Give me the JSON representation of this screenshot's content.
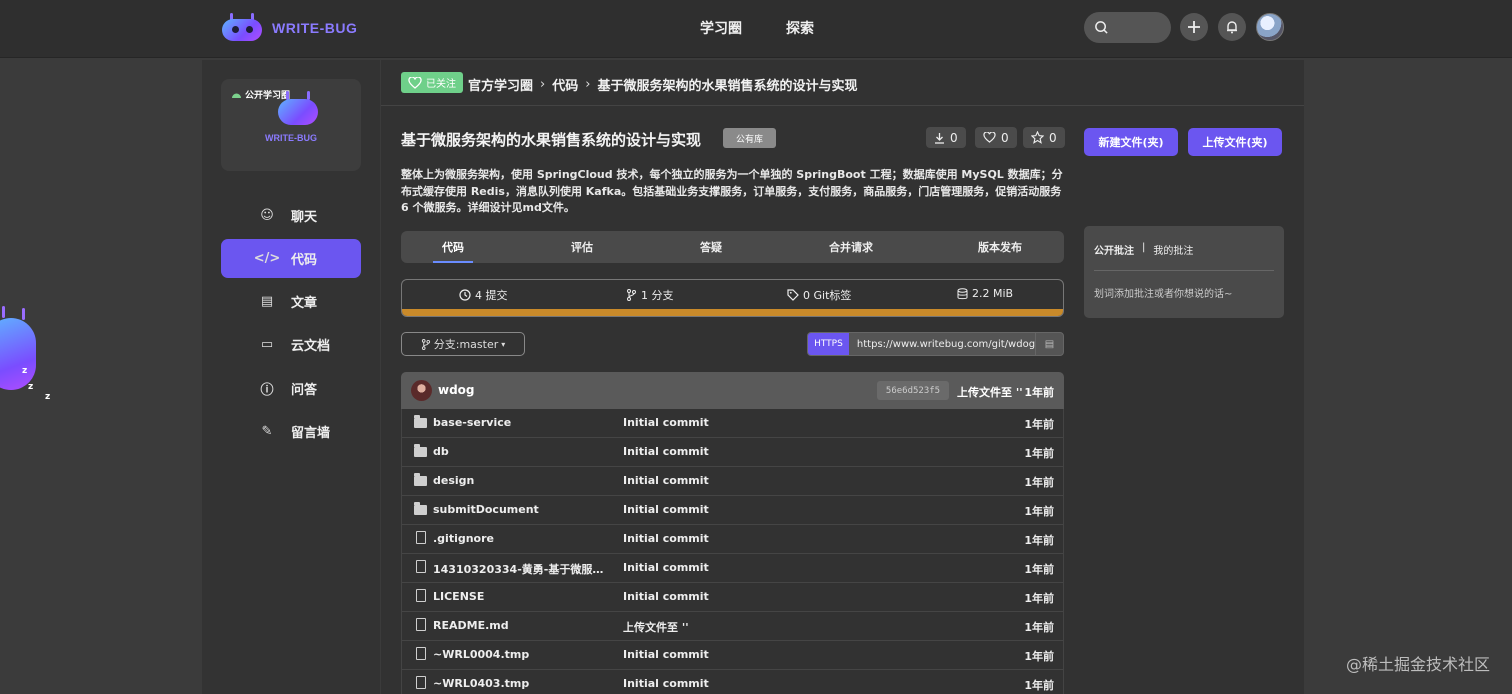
{
  "brand": {
    "name": "WRITE-BUG",
    "accent": "#6b56f0"
  },
  "nav": {
    "items": [
      "学习圈",
      "探索"
    ]
  },
  "topbar": {
    "search_icon": "search-icon",
    "add_icon": "plus-icon",
    "notify_icon": "bell-icon"
  },
  "sidebar": {
    "card": {
      "tag": "公开学习圈",
      "name": "WRITE-BUG"
    },
    "items": [
      {
        "label": "聊天",
        "icon": "chat-icon"
      },
      {
        "label": "代码",
        "icon": "code-icon",
        "active": true
      },
      {
        "label": "文章",
        "icon": "article-icon"
      },
      {
        "label": "云文档",
        "icon": "folder-icon"
      },
      {
        "label": "问答",
        "icon": "question-icon"
      },
      {
        "label": "留言墙",
        "icon": "edit-icon"
      }
    ]
  },
  "breadcrumb": {
    "follow": "已关注",
    "items": [
      "官方学习圈",
      "代码",
      "基于微服务架构的水果销售系统的设计与实现"
    ]
  },
  "repo": {
    "title": "基于微服务架构的水果销售系统的设计与实现",
    "badge": "公有库",
    "downloads": "0",
    "likes": "0",
    "stars": "0",
    "description": "整体上为微服务架构，使用 SpringCloud 技术，每个独立的服务为一个单独的 SpringBoot 工程；数据库使用 MySQL 数据库；分布式缓存使用 Redis，消息队列使用 Kafka。包括基础业务支撑服务，订单服务，支付服务，商品服务，门店管理服务，促销活动服务 6 个微服务。详细设计见md文件。"
  },
  "tabs": [
    "代码",
    "评估",
    "答疑",
    "合并请求",
    "版本发布"
  ],
  "stats": {
    "commits": "4 提交",
    "branches": "1 分支",
    "tags": "0 Git标签",
    "size": "2.2 MiB"
  },
  "branch": {
    "label": "分支:master"
  },
  "clone": {
    "protocol": "HTTPS",
    "url": "https://www.writebug.com/git/wdog"
  },
  "actions": {
    "new_file": "新建文件(夹)",
    "upload": "上传文件(夹)"
  },
  "notes": {
    "public": "公开批注",
    "sep": "|",
    "mine": "我的批注",
    "hint": "划词添加批注或者你想说的话~"
  },
  "commit": {
    "user": "wdog",
    "sha": "56e6d523f5",
    "message": "上传文件至 ''",
    "time": "1年前"
  },
  "files": [
    {
      "type": "folder",
      "name": "base-service",
      "message": "Initial commit",
      "time": "1年前"
    },
    {
      "type": "folder",
      "name": "db",
      "message": "Initial commit",
      "time": "1年前"
    },
    {
      "type": "folder",
      "name": "design",
      "message": "Initial commit",
      "time": "1年前"
    },
    {
      "type": "folder",
      "name": "submitDocument",
      "message": "Initial commit",
      "time": "1年前"
    },
    {
      "type": "file",
      "name": ".gitignore",
      "message": "Initial commit",
      "time": "1年前"
    },
    {
      "type": "file",
      "name": "14310320334-黄勇-基于微服务...",
      "message": "Initial commit",
      "time": "1年前"
    },
    {
      "type": "file",
      "name": "LICENSE",
      "message": "Initial commit",
      "time": "1年前"
    },
    {
      "type": "file",
      "name": "README.md",
      "message": "上传文件至 ''",
      "time": "1年前"
    },
    {
      "type": "file",
      "name": "~WRL0004.tmp",
      "message": "Initial commit",
      "time": "1年前"
    },
    {
      "type": "file",
      "name": "~WRL0403.tmp",
      "message": "Initial commit",
      "time": "1年前"
    }
  ],
  "watermark": "@稀土掘金技术社区"
}
